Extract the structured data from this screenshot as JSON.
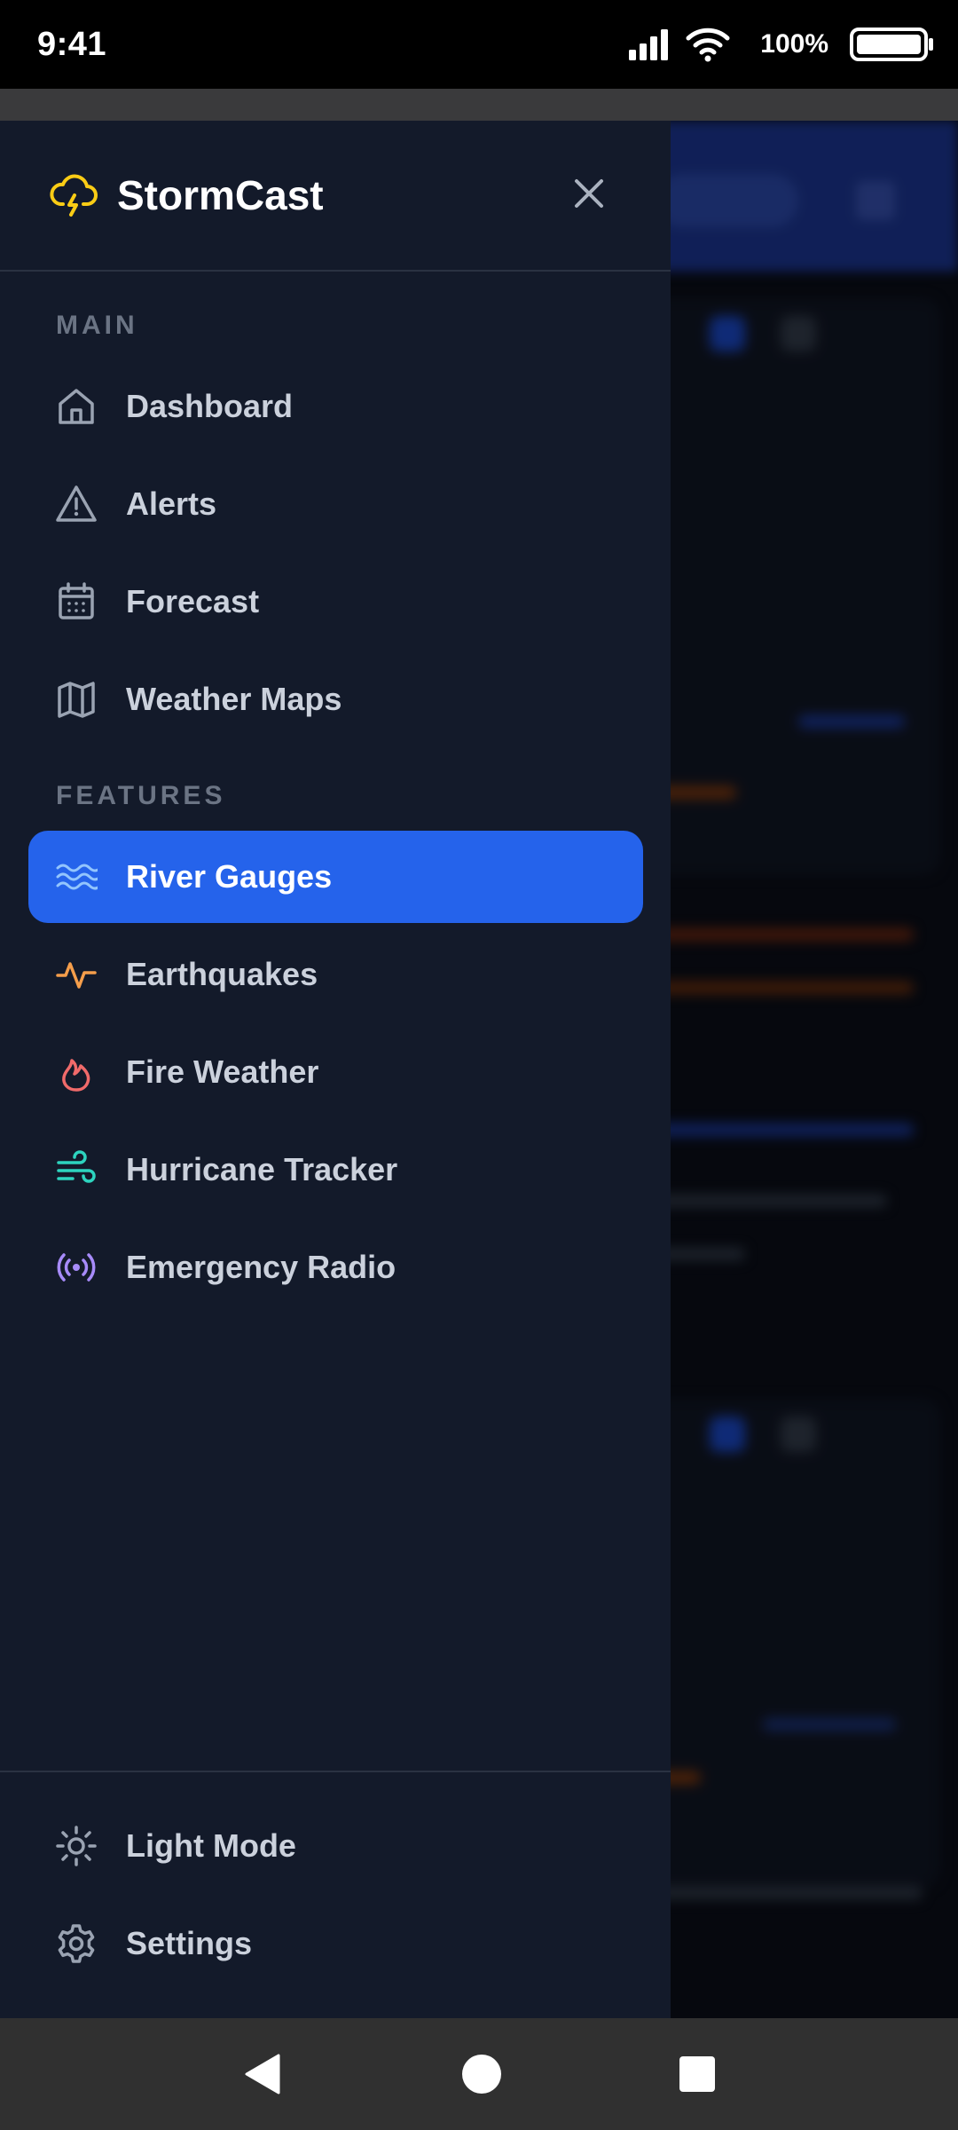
{
  "status_bar": {
    "time": "9:41",
    "battery_percent": "100%",
    "battery_level": 1.0
  },
  "drawer": {
    "brand": "StormCast",
    "sections": {
      "main_label": "MAIN",
      "features_label": "FEATURES"
    },
    "main_items": [
      {
        "label": "Dashboard",
        "icon": "home-icon"
      },
      {
        "label": "Alerts",
        "icon": "warning-triangle-icon"
      },
      {
        "label": "Forecast",
        "icon": "calendar-icon"
      },
      {
        "label": "Weather Maps",
        "icon": "map-icon"
      }
    ],
    "feature_items": [
      {
        "label": "River Gauges",
        "icon": "waves-icon",
        "active": true,
        "color": "#60a5fa"
      },
      {
        "label": "Earthquakes",
        "icon": "activity-icon",
        "color": "#f59e4b"
      },
      {
        "label": "Fire Weather",
        "icon": "flame-icon",
        "color": "#f06a6a"
      },
      {
        "label": "Hurricane Tracker",
        "icon": "wind-icon",
        "color": "#2dd4bf"
      },
      {
        "label": "Emergency Radio",
        "icon": "radio-icon",
        "color": "#a78bfa"
      }
    ],
    "footer_items": [
      {
        "label": "Light Mode",
        "icon": "sun-icon"
      },
      {
        "label": "Settings",
        "icon": "gear-icon"
      }
    ]
  },
  "colors": {
    "drawer_bg": "#131a2a",
    "accent": "#2563eb",
    "logo": "#facc15"
  }
}
